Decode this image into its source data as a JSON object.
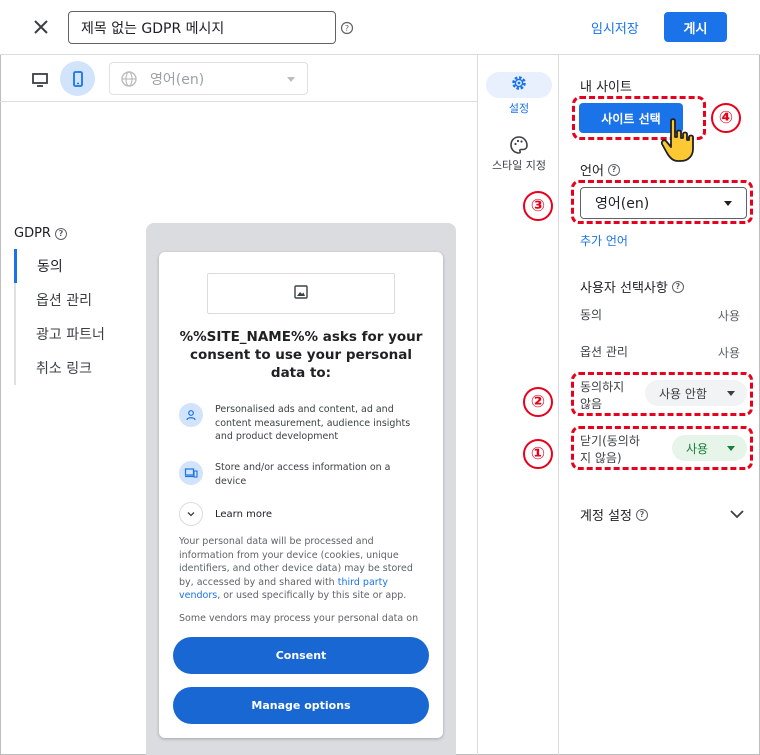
{
  "topbar": {
    "close_icon": "close-icon",
    "title": "제목 없는 GDPR 메시지",
    "help_icon": "help-icon",
    "draft_label": "임시저장",
    "publish_label": "게시"
  },
  "preview_toolbar": {
    "desktop_icon": "desktop-icon",
    "mobile_icon": "mobile-icon",
    "language": "영어(en)"
  },
  "left_nav": {
    "heading": "GDPR",
    "items": [
      {
        "label": "동의",
        "active": true
      },
      {
        "label": "옵션 관리",
        "active": false
      },
      {
        "label": "광고 파트너",
        "active": false
      },
      {
        "label": "취소 링크",
        "active": false
      }
    ]
  },
  "preview": {
    "title": "%%SITE_NAME%% asks for your consent to use your personal data to:",
    "purposes": [
      {
        "icon": "person-icon",
        "text": "Personalised ads and content, ad and content measurement, audience insights and product development"
      },
      {
        "icon": "devices-icon",
        "text": "Store and/or access information on a device"
      }
    ],
    "learn_more": "Learn more",
    "body_part1": "Your personal data will be processed and information from your device (cookies, unique identifiers, and other device data) may be stored by, accessed by and shared with ",
    "body_link": "third party vendors",
    "body_part2": ", or used specifically by this site or app.",
    "body_2": "Some vendors may process your personal data on",
    "consent_btn": "Consent",
    "manage_btn": "Manage options"
  },
  "side_tabs": [
    {
      "label": "설정",
      "icon": "gear-icon",
      "active": true
    },
    {
      "label": "스타일 지정",
      "icon": "palette-icon",
      "active": false
    }
  ],
  "right_panel": {
    "my_site_label": "내 사이트",
    "select_site_btn": "사이트 선택",
    "language_label": "언어",
    "language_value": "영어(en)",
    "add_language": "추가 언어",
    "user_choices_label": "사용자 선택사항",
    "rows": [
      {
        "label": "동의",
        "value": "사용"
      },
      {
        "label": "옵션 관리",
        "value": "사용"
      },
      {
        "label": "동의하지 않음",
        "value": "사용 안함"
      },
      {
        "label": "닫기(동의하지 않음)",
        "value": "사용"
      }
    ],
    "account_settings": "계정 설정"
  },
  "annotations": {
    "badges": [
      "①",
      "②",
      "③",
      "④"
    ],
    "color": "#e8001c"
  },
  "colors": {
    "accent": "#1a73e8",
    "preview_button": "#1967d2",
    "enabled_chip": "#188038"
  }
}
